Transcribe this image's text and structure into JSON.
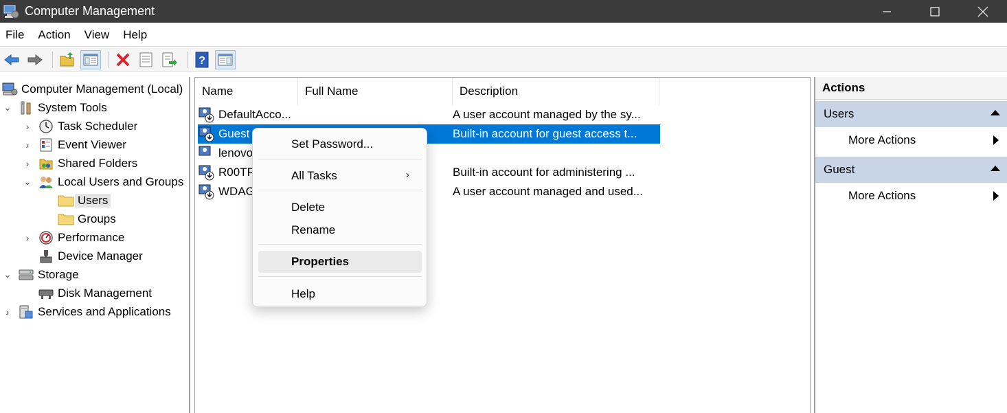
{
  "window": {
    "title": "Computer Management"
  },
  "menu": [
    "File",
    "Action",
    "View",
    "Help"
  ],
  "toolbar": {
    "buttons": [
      "back-arrow-icon",
      "forward-arrow-icon",
      "up-folder-icon",
      "show-hide-tree-icon",
      "delete-icon",
      "properties-icon",
      "export-list-icon",
      "help-icon",
      "show-hide-action-pane-icon"
    ]
  },
  "tree": {
    "root": "Computer Management (Local)",
    "system_tools": "System Tools",
    "task_scheduler": "Task Scheduler",
    "event_viewer": "Event Viewer",
    "shared_folders": "Shared Folders",
    "local_users": "Local Users and Groups",
    "users": "Users",
    "groups": "Groups",
    "performance": "Performance",
    "device_manager": "Device Manager",
    "storage": "Storage",
    "disk_management": "Disk Management",
    "services": "Services and Applications"
  },
  "list": {
    "columns": {
      "name": "Name",
      "fullname": "Full Name",
      "description": "Description"
    },
    "rows": [
      {
        "name": "DefaultAcco...",
        "fullname": "",
        "description": "A user account managed by the sy..."
      },
      {
        "name": "Guest",
        "fullname": "",
        "description": "Built-in account for guest access t..."
      },
      {
        "name": "lenovo",
        "fullname": "",
        "description": ""
      },
      {
        "name": "R00TR",
        "fullname": "",
        "description": "Built-in account for administering ..."
      },
      {
        "name": "WDAG",
        "fullname": "",
        "description": "A user account managed and used..."
      }
    ]
  },
  "context_menu": {
    "set_password": "Set Password...",
    "all_tasks": "All Tasks",
    "delete": "Delete",
    "rename": "Rename",
    "properties": "Properties",
    "help": "Help"
  },
  "actions": {
    "title": "Actions",
    "section1": "Users",
    "section1_more": "More Actions",
    "section2": "Guest",
    "section2_more": "More Actions"
  },
  "colors": {
    "selection": "#0078d7",
    "titlebar": "#3b3b3b",
    "action_header": "#c7d5e7"
  }
}
